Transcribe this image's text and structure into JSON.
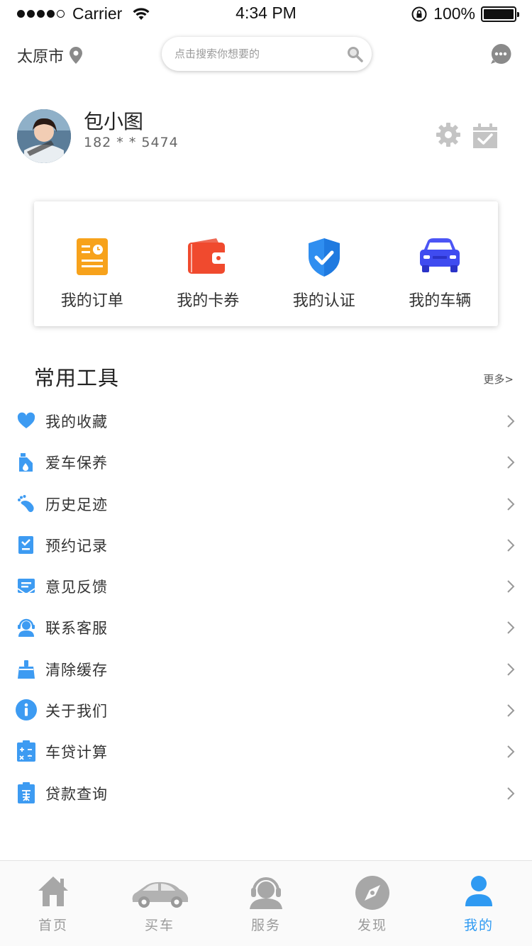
{
  "status_bar": {
    "carrier": "Carrier",
    "time": "4:34 PM",
    "battery": "100%"
  },
  "header": {
    "city": "太原市",
    "search_placeholder": "点击搜索你想要的"
  },
  "profile": {
    "name": "包小图",
    "phone": "182 * * 5474"
  },
  "quick_actions": [
    {
      "label": "我的订单",
      "icon": "orders-icon",
      "color": "#f7a21b"
    },
    {
      "label": "我的卡券",
      "icon": "wallet-icon",
      "color": "#f04a2e"
    },
    {
      "label": "我的认证",
      "icon": "shield-check-icon",
      "color": "#2f8ef0"
    },
    {
      "label": "我的车辆",
      "icon": "car-icon",
      "color": "#3f4bf0"
    }
  ],
  "tools": {
    "title": "常用工具",
    "more": "更多>",
    "items": [
      {
        "label": "我的收藏",
        "icon": "heart-icon"
      },
      {
        "label": "爱车保养",
        "icon": "oil-bottle-icon"
      },
      {
        "label": "历史足迹",
        "icon": "footprint-icon"
      },
      {
        "label": "预约记录",
        "icon": "appointment-icon"
      },
      {
        "label": "意见反馈",
        "icon": "feedback-icon"
      },
      {
        "label": "联系客服",
        "icon": "customer-service-icon"
      },
      {
        "label": "清除缓存",
        "icon": "broom-icon"
      },
      {
        "label": "关于我们",
        "icon": "info-icon"
      },
      {
        "label": "车贷计算",
        "icon": "calculator-icon"
      },
      {
        "label": "贷款查询",
        "icon": "loan-query-icon"
      }
    ]
  },
  "tabbar": [
    {
      "label": "首页",
      "icon": "home-icon",
      "active": false
    },
    {
      "label": "买车",
      "icon": "car-tab-icon",
      "active": false
    },
    {
      "label": "服务",
      "icon": "headset-icon",
      "active": false
    },
    {
      "label": "发现",
      "icon": "compass-icon",
      "active": false
    },
    {
      "label": "我的",
      "icon": "user-icon",
      "active": true
    }
  ],
  "colors": {
    "accent": "#2f9af2",
    "icon_blue": "#3d9bf2",
    "tab_inactive": "#9b9b9b"
  }
}
